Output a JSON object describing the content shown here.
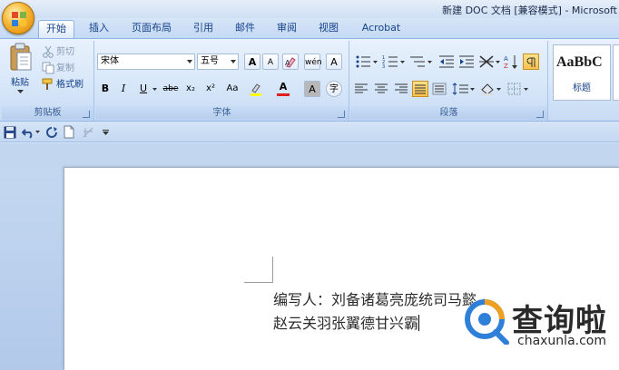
{
  "window": {
    "title": "新建 DOC 文档 [兼容模式] - Microsoft"
  },
  "tabs": [
    {
      "label": "开始",
      "active": true
    },
    {
      "label": "插入"
    },
    {
      "label": "页面布局"
    },
    {
      "label": "引用"
    },
    {
      "label": "邮件"
    },
    {
      "label": "审阅"
    },
    {
      "label": "视图"
    },
    {
      "label": "Acrobat"
    }
  ],
  "ribbon": {
    "clipboard": {
      "label": "剪贴板",
      "paste": "粘贴",
      "cut": "剪切",
      "copy": "复制",
      "format_painter": "格式刷"
    },
    "font": {
      "label": "字体",
      "font_name": "宋体",
      "font_size": "五号",
      "grow": "A",
      "shrink": "A",
      "phonetic": "wén",
      "border_char": "A",
      "bold": "B",
      "italic": "I",
      "underline": "U",
      "strike": "abe",
      "subscript": "x₂",
      "superscript": "x²",
      "change_case": "Aa",
      "font_color": "A",
      "shading": "A",
      "enclose": "字"
    },
    "paragraph": {
      "label": "段落"
    },
    "styles": {
      "preview": "AaBbC",
      "style_name": "标题"
    }
  },
  "document": {
    "lines": [
      "编写人：刘备诸葛亮庞统司马懿",
      "赵云关羽张翼德甘兴霸"
    ],
    "paragraph_mark": "↵"
  },
  "watermark": {
    "text": "查询啦",
    "url": "chaxunla.com"
  },
  "colors": {
    "ribbon_bg": "#d6e6f9",
    "doc_bg": "#c6d9f1",
    "accent_blue": "#15428b",
    "watermark_orange": "#f0a020",
    "watermark_blue": "#2e7fd8"
  }
}
